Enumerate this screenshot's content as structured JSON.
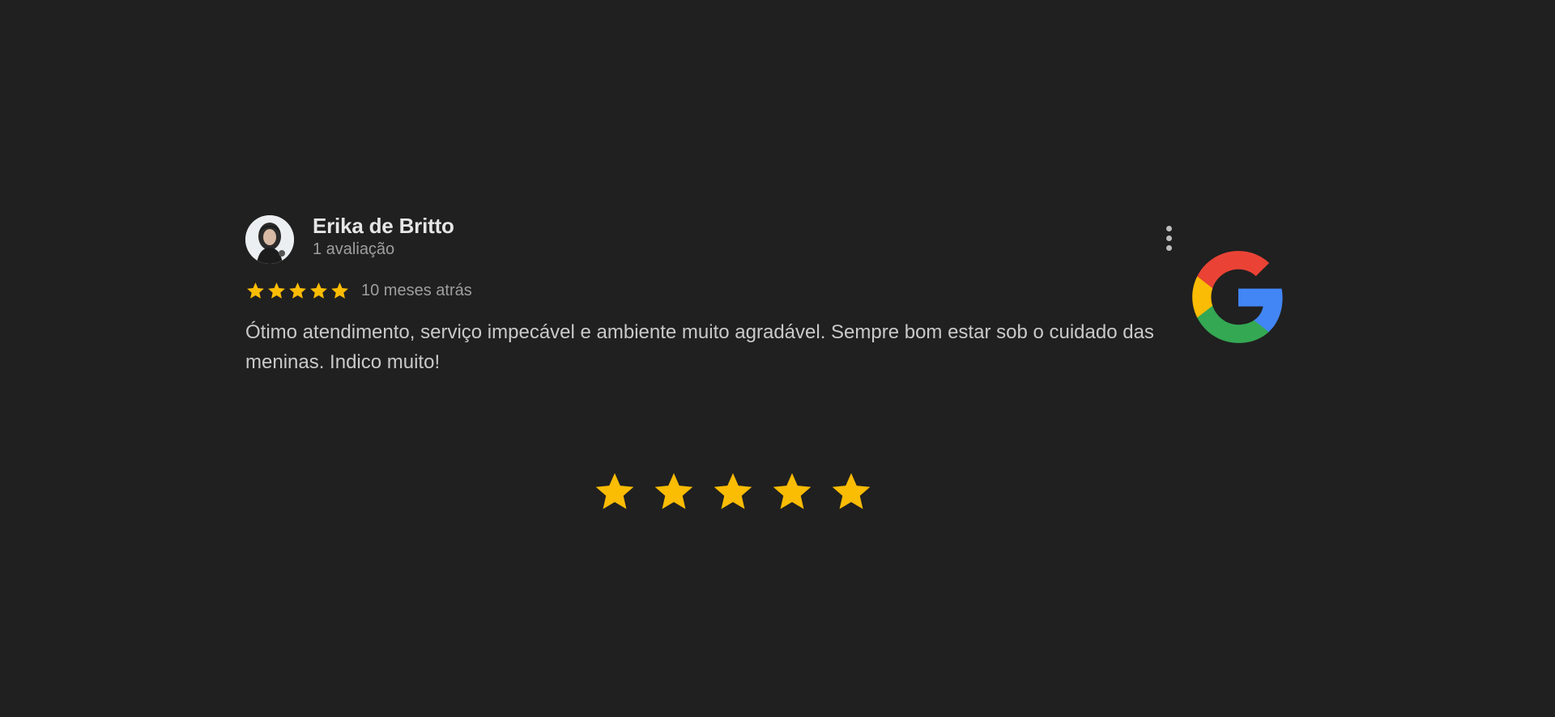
{
  "review": {
    "author_name": "Erika de Britto",
    "review_count": "1 avaliação",
    "rating": 5,
    "rating_max": 5,
    "date": "10 meses atrás",
    "text": "Ótimo atendimento, serviço impecável e ambiente muito agradável. Sempre bom estar sob o cuidado das meninas. Indico muito!"
  },
  "summary": {
    "rating": 5,
    "rating_max": 5
  },
  "icons": {
    "menu": "more-vertical-icon",
    "brand_logo": "google-logo-icon",
    "star": "star-icon"
  },
  "colors": {
    "background": "#202020",
    "star": "#fbbc04",
    "google_blue": "#4285F4",
    "google_red": "#EA4335",
    "google_yellow": "#FBBC05",
    "google_green": "#34A853"
  }
}
